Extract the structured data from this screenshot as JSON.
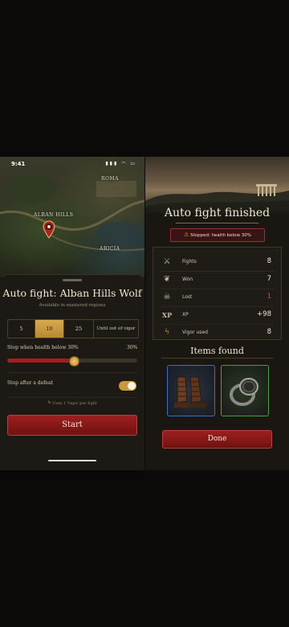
{
  "left_screen": {
    "status_bar": {
      "time": "9:41",
      "icons": "▮▮▮ ◠ ▭"
    },
    "map": {
      "labels": [
        "ROMA",
        "ALBAN HILLS",
        "ARICIA"
      ]
    },
    "sheet": {
      "title": "Auto fight: Alban Hills Wolf",
      "subtitle": "Available in mastered regions",
      "fight_counts": [
        "5",
        "10",
        "25",
        "Until out of vigor"
      ],
      "selected_count": "10",
      "health_label": "Stop when health below 30%",
      "health_value_text": "30%",
      "health_threshold_fraction": 0.3,
      "defeat_label": "Stop after a defeat",
      "defeat_toggle_on": true,
      "vigor_note": "Uses 1 Vigor per fight",
      "start_label": "Start"
    }
  },
  "right_screen": {
    "title": "Auto fight finished",
    "stopped_text": "Stopped: health below 30%",
    "stats": [
      {
        "icon": "crossed-swords-icon",
        "label": "Fights",
        "value": "8"
      },
      {
        "icon": "laurel-wreath-icon",
        "label": "Won",
        "value": "7"
      },
      {
        "icon": "skull-icon",
        "label": "Lost",
        "value": "1",
        "color": "#d84a3c"
      },
      {
        "icon": "xp-icon",
        "icon_text": "XP",
        "label": "XP",
        "value": "+98"
      },
      {
        "icon": "lightning-icon",
        "label": "Vigor used",
        "value": "8"
      }
    ],
    "items_title": "Items found",
    "items": [
      {
        "icon": "sandals-icon",
        "rarity_color": "#3a70c8"
      },
      {
        "icon": "signet-ring-icon",
        "rarity_color": "#4aa046"
      }
    ],
    "done_label": "Done"
  },
  "colors": {
    "accent_gold": "#c99a3c",
    "danger_red": "#9e1f1f",
    "panel": "#1d1a15"
  }
}
